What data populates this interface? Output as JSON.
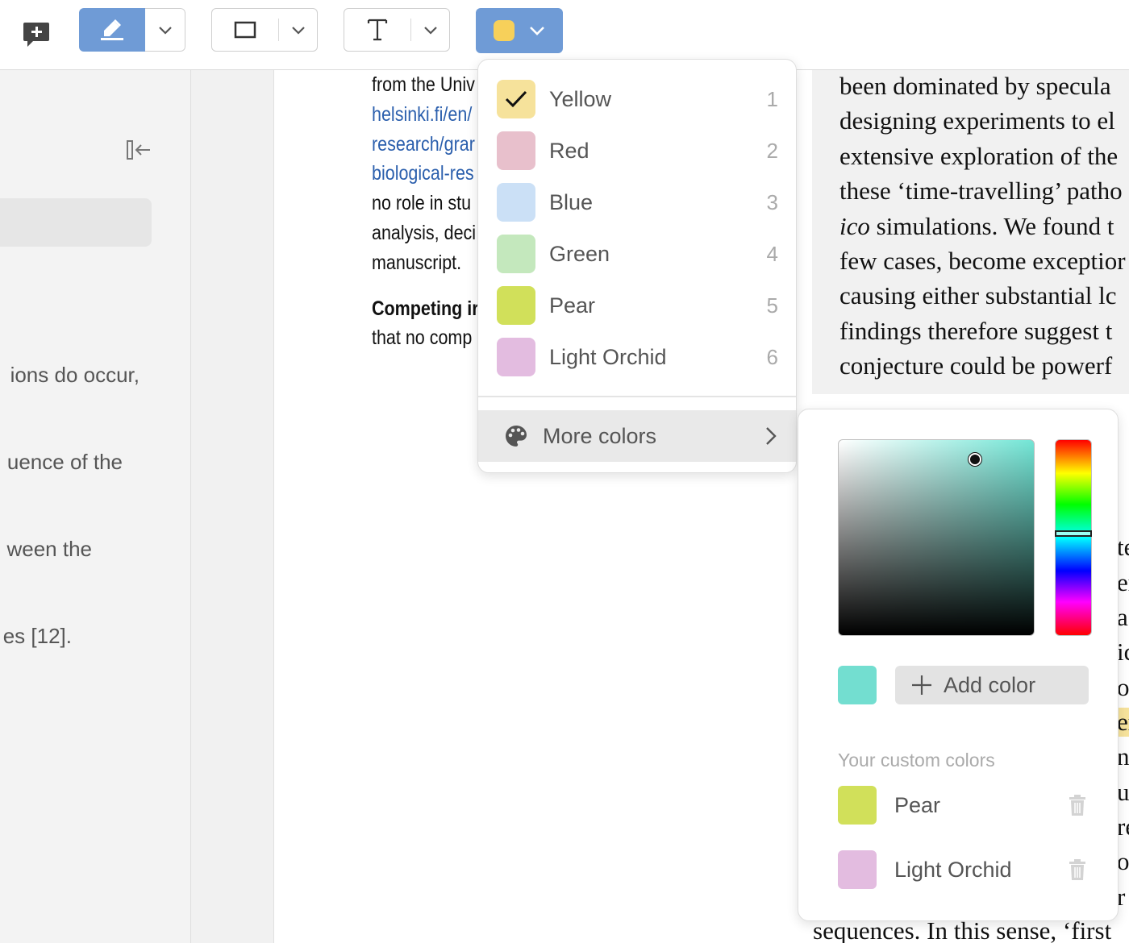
{
  "toolbar": {
    "tools": [
      "add-comment",
      "highlight",
      "rectangle",
      "text",
      "color"
    ],
    "active_tool": "highlight",
    "current_color": "#f7d05a"
  },
  "sidebar": {
    "text_lines": [
      "ions do occur,",
      "uence of the",
      "ween the",
      "es [12]."
    ]
  },
  "document": {
    "left_column": [
      {
        "text": "from the Univ",
        "style": "normal"
      },
      {
        "text": "helsinki.fi/en/",
        "style": "link"
      },
      {
        "text": "research/grar",
        "style": "link"
      },
      {
        "text": "biological-res",
        "style": "link"
      },
      {
        "text": "no role in stu",
        "style": "normal"
      },
      {
        "text": "analysis, deci",
        "style": "normal"
      },
      {
        "text": "manuscript.",
        "style": "normal"
      },
      {
        "text": "Competing ir",
        "style": "bold"
      },
      {
        "text": "that no comp",
        "style": "normal"
      }
    ],
    "right_column": [
      "been dominated by specula",
      "designing experiments to el",
      "extensive exploration of the",
      "these ‘time-travelling’ patho"
    ],
    "right_column_italic_prefix": "ico",
    "right_column_italic_rest": " simulations. We found t",
    "right_column_after": [
      "few cases, become exceptior",
      "causing either substantial lc",
      "findings therefore suggest t",
      "conjecture could be powerf"
    ],
    "right_edge_glyphs": [
      "te",
      "er",
      "a",
      "ic",
      "or",
      "er",
      "n",
      "u",
      "re",
      "of",
      "r"
    ],
    "bottom_line": "sequences. In this sense, ‘first"
  },
  "color_menu": {
    "options": [
      {
        "label": "Yellow",
        "shortcut": "1",
        "color": "#f6e29b",
        "selected": true
      },
      {
        "label": "Red",
        "shortcut": "2",
        "color": "#e8c0cc",
        "selected": false
      },
      {
        "label": "Blue",
        "shortcut": "3",
        "color": "#cbe0f6",
        "selected": false
      },
      {
        "label": "Green",
        "shortcut": "4",
        "color": "#c4e8bd",
        "selected": false
      },
      {
        "label": "Pear",
        "shortcut": "5",
        "color": "#d1e05a",
        "selected": false
      },
      {
        "label": "Light Orchid",
        "shortcut": "6",
        "color": "#e3bce0",
        "selected": false
      }
    ],
    "more_colors_label": "More colors"
  },
  "color_picker": {
    "base_hue_color": "#73e6d6",
    "saturation": 0.7,
    "brightness": 0.9,
    "hue_position": 0.48,
    "selected_color": "#73ded0",
    "add_color_label": "Add color",
    "custom_colors_title": "Your custom colors",
    "custom_colors": [
      {
        "label": "Pear",
        "color": "#d1e05a"
      },
      {
        "label": "Light Orchid",
        "color": "#e3bce0"
      }
    ]
  }
}
